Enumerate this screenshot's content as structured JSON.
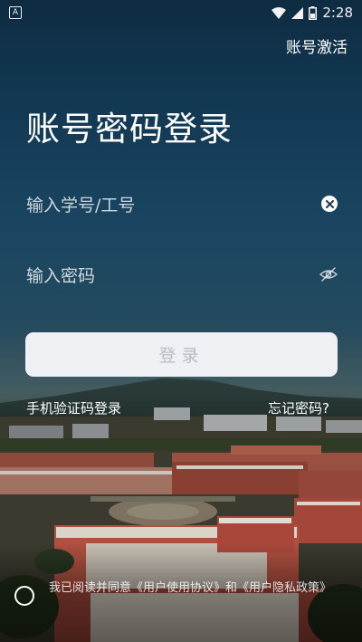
{
  "status_bar": {
    "time": "2:28",
    "notification_icon": "a-icon",
    "wifi_icon": "wifi-icon",
    "signal_icon": "signal-icon",
    "battery_icon": "battery-icon"
  },
  "header": {
    "activate_label": "账号激活"
  },
  "page": {
    "title": "账号密码登录"
  },
  "form": {
    "username_placeholder": "输入学号/工号",
    "password_placeholder": "输入密码",
    "clear_icon": "clear-icon",
    "eye_icon": "eye-slash-icon",
    "login_label": "登录"
  },
  "links": {
    "sms_login": "手机验证码登录",
    "forgot_password": "忘记密码?"
  },
  "agreement": {
    "checked": false,
    "text": "我已阅读并同意《用户使用协议》和《用户隐私政策》"
  },
  "colors": {
    "button_bg": "#eef0f3",
    "button_text": "#b7bcc4",
    "text": "#ffffff"
  }
}
